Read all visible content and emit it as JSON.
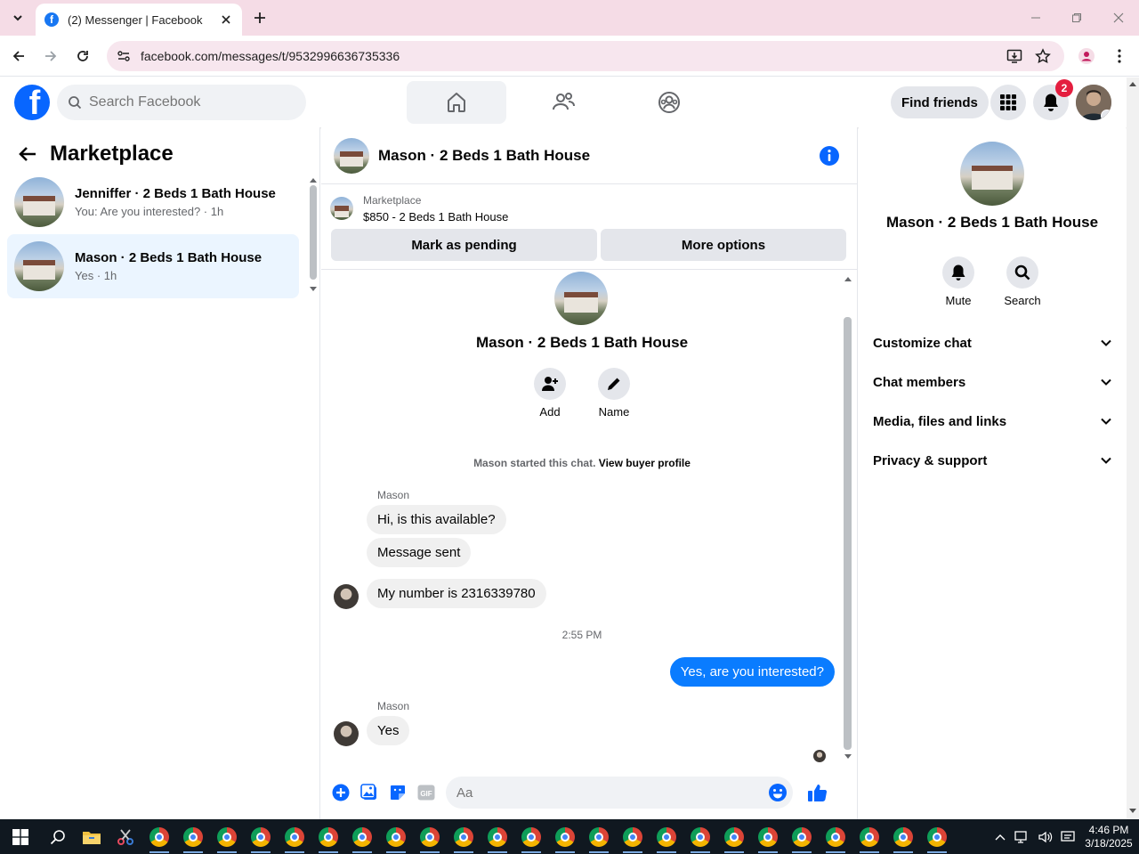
{
  "browser": {
    "tab_title": "(2) Messenger | Facebook",
    "url": "facebook.com/messages/t/9532996636735336"
  },
  "header": {
    "search_placeholder": "Search Facebook",
    "find_friends": "Find friends",
    "notification_count": "2"
  },
  "left": {
    "title": "Marketplace",
    "conversations": [
      {
        "name": "Jenniffer · 2 Beds 1 Bath House",
        "preview": "You: Are you interested? · 1h"
      },
      {
        "name": "Mason · 2 Beds 1 Bath House",
        "preview": "Yes · 1h"
      }
    ]
  },
  "chat": {
    "title": "Mason · 2 Beds 1 Bath House",
    "listing_label": "Marketplace",
    "listing_price": "$850 - 2 Beds 1 Bath House",
    "mark_pending": "Mark as pending",
    "more_options": "More options",
    "profile_name": "Mason · 2 Beds 1 Bath House",
    "add_label": "Add",
    "name_label": "Name",
    "system_msg": "Mason started this chat.",
    "view_profile": "View buyer profile",
    "sender1": "Mason",
    "msg1": "Hi, is this available?",
    "msg2": "Message sent",
    "msg3": "My number is 2316339780",
    "time": "2:55 PM",
    "msg_out": "Yes, are you interested?",
    "sender2": "Mason",
    "msg4": "Yes",
    "composer_placeholder": "Aa"
  },
  "right": {
    "name": "Mason · 2 Beds 1 Bath House",
    "mute": "Mute",
    "search": "Search",
    "rows": [
      "Customize chat",
      "Chat members",
      "Media, files and links",
      "Privacy & support"
    ]
  },
  "taskbar": {
    "time": "4:46 PM",
    "date": "3/18/2025"
  },
  "colors": {
    "fb_blue": "#0866ff",
    "outgoing_bubble": "#0a7cff",
    "active_conversation": "#ebf5ff"
  }
}
